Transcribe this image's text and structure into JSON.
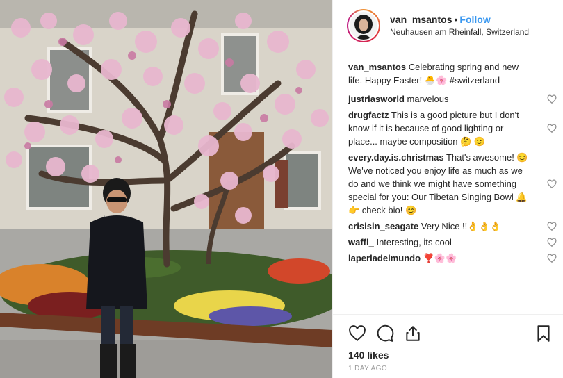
{
  "post": {
    "username": "van_msantos",
    "separator": "•",
    "follow_label": "Follow",
    "location": "Neuhausen am Rheinfall, Switzerland",
    "likes": "140 likes",
    "timestamp": "1 DAY AGO"
  },
  "comments": [
    {
      "user": "van_msantos",
      "text": "Celebrating spring and new life. Happy Easter! 🐣🌸 #switzerland",
      "caption": true
    },
    {
      "user": "justriasworld",
      "text": "marvelous"
    },
    {
      "user": "drugfactz",
      "text": "This is a good picture but I don't know if it is because of good lighting or place... maybe composition 🤔 🙂"
    },
    {
      "user": "every.day.is.christmas",
      "text": "That's awesome! 😊 We've noticed you enjoy life as much as we do and we think we might have something special for you: Our Tibetan Singing Bowl 🔔 👉 check bio! 😊"
    },
    {
      "user": "crisisin_seagate",
      "text": "Very Nice !!👌👌👌"
    },
    {
      "user": "waffl_",
      "text": "Interesting, its cool"
    },
    {
      "user": "laperladelmundo",
      "text": "❣️🌸🌸"
    }
  ],
  "icons": {
    "heart": "heart-outline-icon",
    "comment": "comment-bubble-icon",
    "share": "share-icon",
    "save": "bookmark-icon"
  },
  "colors": {
    "link": "#3897f0",
    "text": "#262626",
    "muted": "#999999",
    "blossom": "#e8b7cf"
  }
}
